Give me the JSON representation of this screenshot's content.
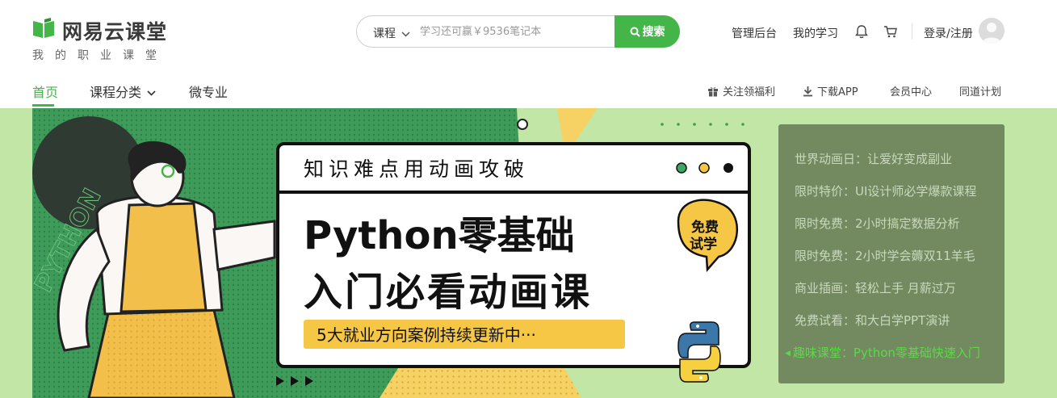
{
  "brand": {
    "name": "网易云课堂",
    "slogan": "我的职业课堂",
    "color": "#44b549"
  },
  "search": {
    "category": "课程",
    "placeholder": "学习还可赢￥9536笔记本",
    "button_label": "搜索"
  },
  "top_links": {
    "admin": "管理后台",
    "my_learning": "我的学习",
    "login": "登录/注册"
  },
  "icons": {
    "notifications": "bell-icon",
    "cart": "cart-icon",
    "user": "avatar"
  },
  "nav": {
    "items": [
      {
        "label": "首页",
        "active": true
      },
      {
        "label": "课程分类"
      },
      {
        "label": "微专业"
      }
    ],
    "right_items": [
      {
        "label": "关注领福利",
        "icon": "gift-icon"
      },
      {
        "label": "下载APP",
        "icon": "download-icon"
      },
      {
        "label": "会员中心"
      },
      {
        "label": "同道计划"
      }
    ]
  },
  "banner": {
    "window_title": "知识难点用动画攻破",
    "headline_line1": "Python零基础",
    "headline_line2": "入门必看动画课",
    "tagline": "5大就业方向案例持续更新中···",
    "bubble_line1": "免费",
    "bubble_line2": "试学",
    "pattern_text": "PYTHON",
    "background": "#c1e6a5"
  },
  "side_panel": {
    "items": [
      {
        "label": "世界动画日：让爱好变成副业"
      },
      {
        "label": "限时特价：UI设计师必学爆款课程"
      },
      {
        "label": "限时免费：2小时搞定数据分析"
      },
      {
        "label": "限时免费：2小时学会薅双11羊毛"
      },
      {
        "label": "商业插画：轻松上手 月薪过万"
      },
      {
        "label": "免费试看：和大白学PPT演讲"
      },
      {
        "label": "趣味课堂：Python零基础快速入门",
        "active": true
      }
    ]
  }
}
